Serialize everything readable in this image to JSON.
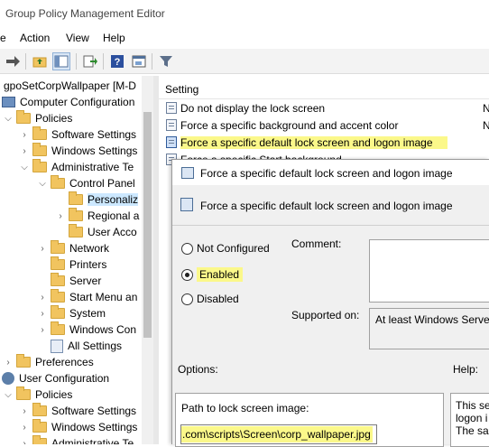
{
  "window": {
    "title": "Group Policy Management Editor"
  },
  "menu": [
    "e",
    "Action",
    "View",
    "Help"
  ],
  "toolbar": {
    "icons": [
      "forward-arrow-icon",
      "up-folder-icon",
      "show-hide-tree-icon",
      "export-list-icon",
      "help-icon",
      "properties-icon",
      "filter-icon"
    ]
  },
  "tree": {
    "root": "gpoSetCorpWallpaper [M-D",
    "items": [
      {
        "label": "Computer Configuration",
        "type": "pc"
      },
      {
        "label": "Policies",
        "type": "folder"
      },
      {
        "label": "Software Settings",
        "type": "folder"
      },
      {
        "label": "Windows Settings",
        "type": "folder"
      },
      {
        "label": "Administrative Te",
        "type": "folder"
      },
      {
        "label": "Control Panel",
        "type": "folder"
      },
      {
        "label": "Personaliz",
        "type": "folder",
        "selected": true
      },
      {
        "label": "Regional a",
        "type": "folder"
      },
      {
        "label": "User Acco",
        "type": "folder"
      },
      {
        "label": "Network",
        "type": "folder"
      },
      {
        "label": "Printers",
        "type": "folder"
      },
      {
        "label": "Server",
        "type": "folder"
      },
      {
        "label": "Start Menu an",
        "type": "folder"
      },
      {
        "label": "System",
        "type": "folder"
      },
      {
        "label": "Windows Con",
        "type": "folder"
      },
      {
        "label": "All Settings",
        "type": "doc"
      },
      {
        "label": "Preferences",
        "type": "folder"
      },
      {
        "label": "User Configuration",
        "type": "user"
      },
      {
        "label": "Policies",
        "type": "folder"
      },
      {
        "label": "Software Settings",
        "type": "folder"
      },
      {
        "label": "Windows Settings",
        "type": "folder"
      },
      {
        "label": "Administrative Te",
        "type": "folder"
      }
    ]
  },
  "list": {
    "header": "Setting",
    "rows": [
      {
        "label": "Do not display the lock screen",
        "state": "N"
      },
      {
        "label": "Force a specific background and accent color",
        "state": "N"
      },
      {
        "label": "Force a specific default lock screen and logon image",
        "state": ""
      },
      {
        "label": "Force a specific Start background",
        "state": ""
      }
    ]
  },
  "dialog": {
    "title": "Force a specific default lock screen and logon image",
    "subtitle": "Force a specific default lock screen and logon image",
    "options": {
      "not_configured": "Not Configured",
      "enabled": "Enabled",
      "disabled": "Disabled"
    },
    "selected_option": "Enabled",
    "comment_label": "Comment:",
    "supported_label": "Supported on:",
    "supported_value": "At least Windows Server",
    "options_label": "Options:",
    "help_label": "Help:",
    "path_label": "Path to lock screen image:",
    "path_value": ".com\\scripts\\Screen\\corp_wallpaper.jpg",
    "help_text": [
      "This set",
      "logon i",
      "The sa"
    ]
  },
  "colors": {
    "highlight": "#fbf88a",
    "selection": "#cce8ff"
  }
}
